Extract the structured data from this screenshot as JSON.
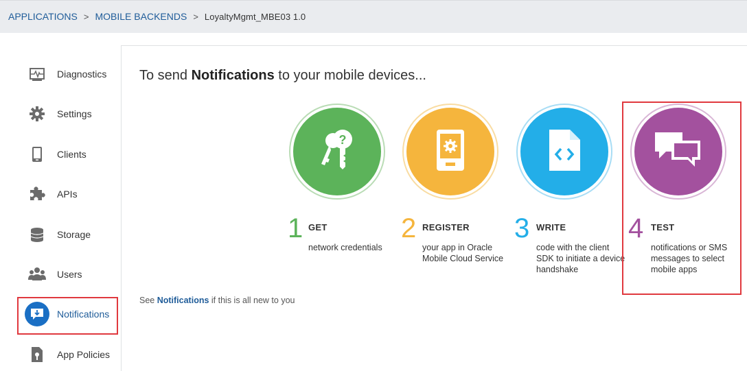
{
  "breadcrumb": {
    "applications": "APPLICATIONS",
    "mobile_backends": "MOBILE BACKENDS",
    "sep": ">",
    "current": "LoyaltyMgmt_MBE03  1.0"
  },
  "sidebar": {
    "items": [
      {
        "label": "Diagnostics",
        "icon": "diagnostics-icon"
      },
      {
        "label": "Settings",
        "icon": "gear-icon"
      },
      {
        "label": "Clients",
        "icon": "phone-icon"
      },
      {
        "label": "APIs",
        "icon": "puzzle-icon"
      },
      {
        "label": "Storage",
        "icon": "database-icon"
      },
      {
        "label": "Users",
        "icon": "users-icon"
      },
      {
        "label": "Notifications",
        "icon": "notifications-icon"
      },
      {
        "label": "App Policies",
        "icon": "policy-icon"
      }
    ],
    "active": "Notifications"
  },
  "main": {
    "title_prefix": "To send ",
    "title_bold": "Notifications",
    "title_suffix": " to your mobile devices...",
    "steps": [
      {
        "num": "1",
        "title": "GET",
        "desc": "network credentials",
        "icon": "keys-icon",
        "color": "#5cb35a"
      },
      {
        "num": "2",
        "title": "REGISTER",
        "desc": "your app in Oracle Mobile Cloud Service",
        "icon": "phone-gear-icon",
        "color": "#f5b53d"
      },
      {
        "num": "3",
        "title": "WRITE",
        "desc": "code with the client SDK to initiate a device handshake",
        "icon": "code-file-icon",
        "color": "#23aee8"
      },
      {
        "num": "4",
        "title": "TEST",
        "desc": "notifications or SMS messages to select mobile apps",
        "icon": "chat-bubbles-icon",
        "color": "#a3519e"
      }
    ],
    "see_prefix": "See ",
    "see_link": "Notifications",
    "see_suffix": " if this is all new to you"
  },
  "colors": {
    "link": "#1f5c99",
    "highlight": "#e0383e",
    "active_icon": "#1a6fc4",
    "topbar_bg": "#eaecef"
  }
}
